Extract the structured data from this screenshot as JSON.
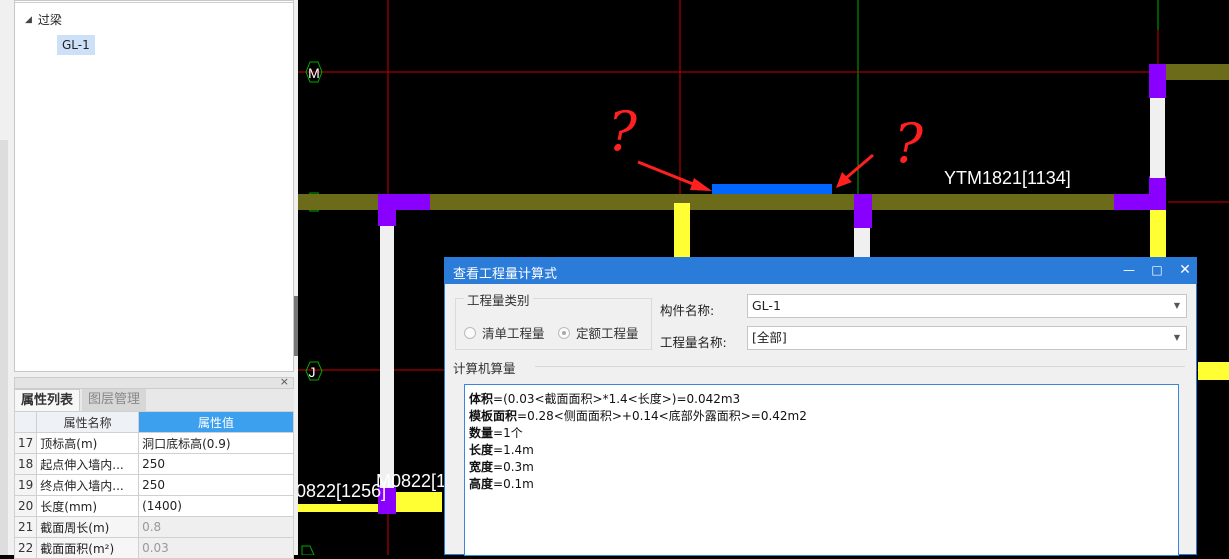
{
  "tree": {
    "parent_label": "过梁",
    "child_label": "GL-1"
  },
  "props_panel": {
    "tab_props": "属性列表",
    "tab_layers": "图层管理",
    "col_name": "属性名称",
    "col_value": "属性值",
    "rows": [
      {
        "num": "17",
        "name": "顶标高(m)",
        "value": "洞口底标高(0.9)",
        "disabled": false
      },
      {
        "num": "18",
        "name": "起点伸入墙内...",
        "value": "250",
        "disabled": false
      },
      {
        "num": "19",
        "name": "终点伸入墙内...",
        "value": "250",
        "disabled": false
      },
      {
        "num": "20",
        "name": "长度(mm)",
        "value": "(1400)",
        "disabled": false
      },
      {
        "num": "21",
        "name": "截面周长(m)",
        "value": "0.8",
        "disabled": true
      },
      {
        "num": "22",
        "name": "截面面积(m²)",
        "value": "0.03",
        "disabled": true
      }
    ]
  },
  "cad": {
    "axis_labels": [
      "M",
      "J"
    ],
    "annotation_question_1": "?",
    "annotation_question_2": "?",
    "label_ytm": "YTM1821[1134]",
    "label_m0822_a": "0822[1256]",
    "label_m0822_b": "M0822[1"
  },
  "dialog": {
    "title": "查看工程量计算式",
    "group_title": "工程量类别",
    "radio_list": "清单工程量",
    "radio_quota": "定额工程量",
    "radio_selected": "定额工程量",
    "component_label": "构件名称:",
    "component_value": "GL-1",
    "quantity_label": "工程量名称:",
    "quantity_value": "[全部]",
    "calc_label": "计算机算量",
    "calc_lines": [
      {
        "key": "体积",
        "rest": "=(0.03<截面面积>*1.4<长度>)=0.042m3"
      },
      {
        "key": "模板面积",
        "rest": "=0.28<侧面面积>+0.14<底部外露面积>=0.42m2"
      },
      {
        "key": "数量",
        "rest": "=1个"
      },
      {
        "key": "长度",
        "rest": "=1.4m"
      },
      {
        "key": "宽度",
        "rest": "=0.3m"
      },
      {
        "key": "高度",
        "rest": "=0.1m"
      }
    ]
  },
  "colors": {
    "dialog_title_bg": "#2b7bd8",
    "prop_header_active": "#3da0ee",
    "wall_olive": "#6b6b1a",
    "column_purple": "#8a00ff",
    "grid_red": "#cc0000",
    "grid_green": "#00aa00",
    "highlight_blue": "#0066ff",
    "annotation_red": "#ff2020",
    "yellow_wall": "#ffff33"
  }
}
